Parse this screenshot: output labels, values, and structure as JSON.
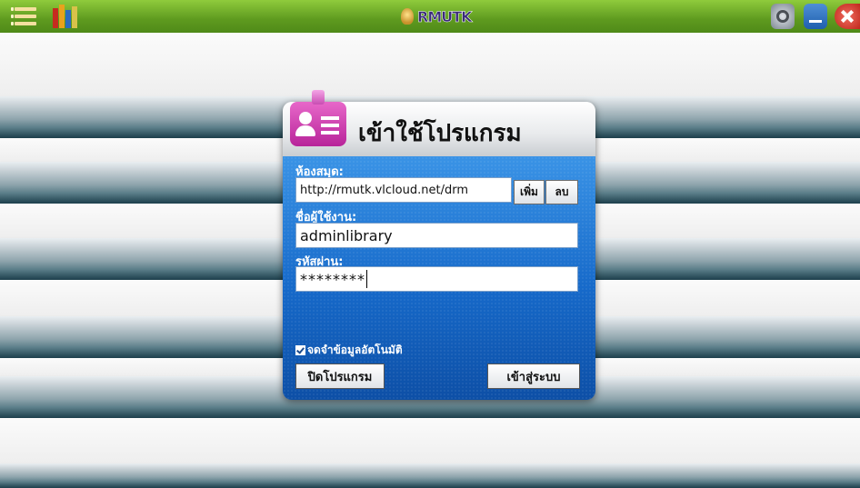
{
  "topbar": {
    "menu_icon": "list-icon",
    "library_icon": "bookshelf-icon",
    "logo_text": "RMUTK",
    "settings_icon": "gear-icon",
    "minimize_icon": "minimize-icon",
    "close_icon": "close-icon"
  },
  "dialog": {
    "title": "เข้าใช้โปรแกรม",
    "icon": "user-card-icon",
    "library_label": "ห้องสมุด:",
    "library_value": "http://rmutk.vlcloud.net/drm",
    "add_label": "เพิ่ม",
    "delete_label": "ลบ",
    "username_label": "ชื่อผู้ใช้งาน:",
    "username_value": "adminlibrary",
    "password_label": "รหัสผ่าน:",
    "password_value": "********",
    "remember_label": "จดจำข้อมูลอัตโนมัติ",
    "remember_checked": true,
    "exit_label": "ปิดโปรแกรม",
    "login_label": "เข้าสู่ระบบ"
  },
  "colors": {
    "topbar": "#6aa726",
    "dialog_blue": "#1669c9",
    "shelf": "#3a5d69",
    "icon_pink": "#d23fb4"
  }
}
